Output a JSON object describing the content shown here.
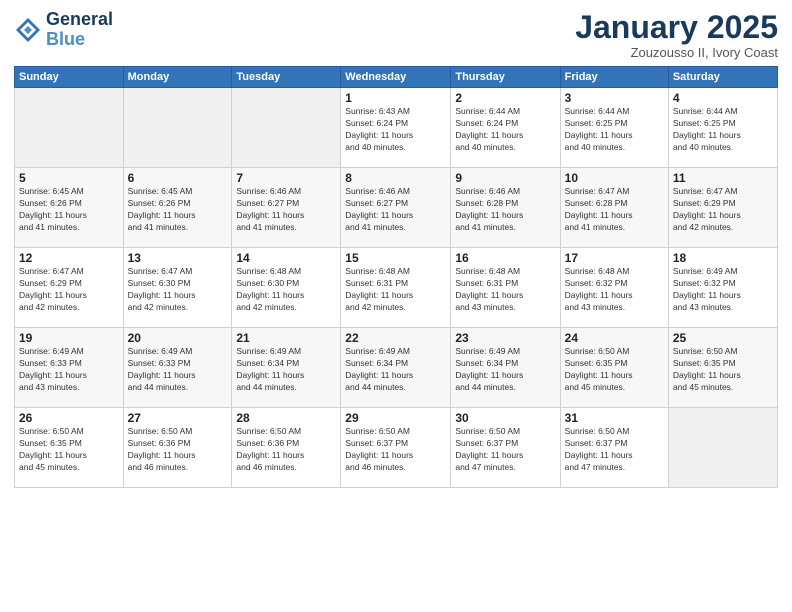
{
  "logo": {
    "line1": "General",
    "line2": "Blue"
  },
  "title": "January 2025",
  "subtitle": "Zouzousso II, Ivory Coast",
  "header_days": [
    "Sunday",
    "Monday",
    "Tuesday",
    "Wednesday",
    "Thursday",
    "Friday",
    "Saturday"
  ],
  "weeks": [
    [
      {
        "day": "",
        "info": ""
      },
      {
        "day": "",
        "info": ""
      },
      {
        "day": "",
        "info": ""
      },
      {
        "day": "1",
        "info": "Sunrise: 6:43 AM\nSunset: 6:24 PM\nDaylight: 11 hours\nand 40 minutes."
      },
      {
        "day": "2",
        "info": "Sunrise: 6:44 AM\nSunset: 6:24 PM\nDaylight: 11 hours\nand 40 minutes."
      },
      {
        "day": "3",
        "info": "Sunrise: 6:44 AM\nSunset: 6:25 PM\nDaylight: 11 hours\nand 40 minutes."
      },
      {
        "day": "4",
        "info": "Sunrise: 6:44 AM\nSunset: 6:25 PM\nDaylight: 11 hours\nand 40 minutes."
      }
    ],
    [
      {
        "day": "5",
        "info": "Sunrise: 6:45 AM\nSunset: 6:26 PM\nDaylight: 11 hours\nand 41 minutes."
      },
      {
        "day": "6",
        "info": "Sunrise: 6:45 AM\nSunset: 6:26 PM\nDaylight: 11 hours\nand 41 minutes."
      },
      {
        "day": "7",
        "info": "Sunrise: 6:46 AM\nSunset: 6:27 PM\nDaylight: 11 hours\nand 41 minutes."
      },
      {
        "day": "8",
        "info": "Sunrise: 6:46 AM\nSunset: 6:27 PM\nDaylight: 11 hours\nand 41 minutes."
      },
      {
        "day": "9",
        "info": "Sunrise: 6:46 AM\nSunset: 6:28 PM\nDaylight: 11 hours\nand 41 minutes."
      },
      {
        "day": "10",
        "info": "Sunrise: 6:47 AM\nSunset: 6:28 PM\nDaylight: 11 hours\nand 41 minutes."
      },
      {
        "day": "11",
        "info": "Sunrise: 6:47 AM\nSunset: 6:29 PM\nDaylight: 11 hours\nand 42 minutes."
      }
    ],
    [
      {
        "day": "12",
        "info": "Sunrise: 6:47 AM\nSunset: 6:29 PM\nDaylight: 11 hours\nand 42 minutes."
      },
      {
        "day": "13",
        "info": "Sunrise: 6:47 AM\nSunset: 6:30 PM\nDaylight: 11 hours\nand 42 minutes."
      },
      {
        "day": "14",
        "info": "Sunrise: 6:48 AM\nSunset: 6:30 PM\nDaylight: 11 hours\nand 42 minutes."
      },
      {
        "day": "15",
        "info": "Sunrise: 6:48 AM\nSunset: 6:31 PM\nDaylight: 11 hours\nand 42 minutes."
      },
      {
        "day": "16",
        "info": "Sunrise: 6:48 AM\nSunset: 6:31 PM\nDaylight: 11 hours\nand 43 minutes."
      },
      {
        "day": "17",
        "info": "Sunrise: 6:48 AM\nSunset: 6:32 PM\nDaylight: 11 hours\nand 43 minutes."
      },
      {
        "day": "18",
        "info": "Sunrise: 6:49 AM\nSunset: 6:32 PM\nDaylight: 11 hours\nand 43 minutes."
      }
    ],
    [
      {
        "day": "19",
        "info": "Sunrise: 6:49 AM\nSunset: 6:33 PM\nDaylight: 11 hours\nand 43 minutes."
      },
      {
        "day": "20",
        "info": "Sunrise: 6:49 AM\nSunset: 6:33 PM\nDaylight: 11 hours\nand 44 minutes."
      },
      {
        "day": "21",
        "info": "Sunrise: 6:49 AM\nSunset: 6:34 PM\nDaylight: 11 hours\nand 44 minutes."
      },
      {
        "day": "22",
        "info": "Sunrise: 6:49 AM\nSunset: 6:34 PM\nDaylight: 11 hours\nand 44 minutes."
      },
      {
        "day": "23",
        "info": "Sunrise: 6:49 AM\nSunset: 6:34 PM\nDaylight: 11 hours\nand 44 minutes."
      },
      {
        "day": "24",
        "info": "Sunrise: 6:50 AM\nSunset: 6:35 PM\nDaylight: 11 hours\nand 45 minutes."
      },
      {
        "day": "25",
        "info": "Sunrise: 6:50 AM\nSunset: 6:35 PM\nDaylight: 11 hours\nand 45 minutes."
      }
    ],
    [
      {
        "day": "26",
        "info": "Sunrise: 6:50 AM\nSunset: 6:35 PM\nDaylight: 11 hours\nand 45 minutes."
      },
      {
        "day": "27",
        "info": "Sunrise: 6:50 AM\nSunset: 6:36 PM\nDaylight: 11 hours\nand 46 minutes."
      },
      {
        "day": "28",
        "info": "Sunrise: 6:50 AM\nSunset: 6:36 PM\nDaylight: 11 hours\nand 46 minutes."
      },
      {
        "day": "29",
        "info": "Sunrise: 6:50 AM\nSunset: 6:37 PM\nDaylight: 11 hours\nand 46 minutes."
      },
      {
        "day": "30",
        "info": "Sunrise: 6:50 AM\nSunset: 6:37 PM\nDaylight: 11 hours\nand 47 minutes."
      },
      {
        "day": "31",
        "info": "Sunrise: 6:50 AM\nSunset: 6:37 PM\nDaylight: 11 hours\nand 47 minutes."
      },
      {
        "day": "",
        "info": ""
      }
    ]
  ]
}
